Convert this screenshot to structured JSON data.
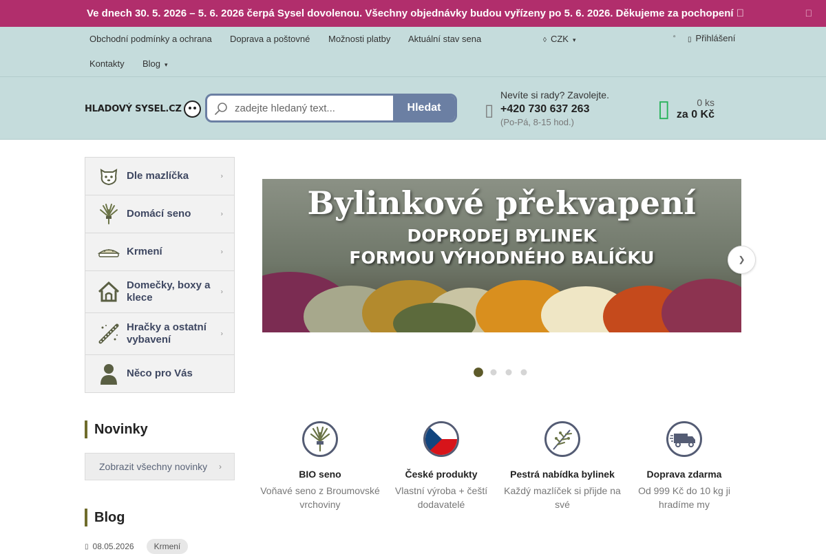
{
  "notice": {
    "text": "Ve dnech 30. 5. 2026 – 5. 6. 2026 čerpá Sysel dovolenou. Všechny objednávky budou vyřízeny po 5. 6. 2026. Děkujeme za pochopení ",
    "close": ""
  },
  "topnav": {
    "items": [
      "Obchodní podmínky a ochrana",
      "Doprava a poštovné",
      "Možnosti platby",
      "Aktuální stav sena",
      "Kontakty",
      "Blog"
    ],
    "currency": "CZK",
    "login": "Přihlášení"
  },
  "header": {
    "logo_text": "HLADOVÝ SYSEL.CZ",
    "search_placeholder": "zadejte hledaný text...",
    "search_button": "Hledat",
    "phone_prompt": "Nevíte si rady? Zavolejte.",
    "phone_number": "+420 730 637 263",
    "phone_hours": "(Po-Pá, 8-15 hod.)",
    "cart_count": "0 ks",
    "cart_total": "za 0 Kč"
  },
  "categories": [
    {
      "label": "Dle mazlíčka",
      "icon": "pet-face-icon"
    },
    {
      "label": "Domácí seno",
      "icon": "hay-icon"
    },
    {
      "label": "Krmení",
      "icon": "food-bowl-icon"
    },
    {
      "label": "Domečky, boxy a klece",
      "icon": "house-icon"
    },
    {
      "label": "Hračky a ostatní vybavení",
      "icon": "toys-icon"
    },
    {
      "label": "Něco pro Vás",
      "icon": "person-icon"
    }
  ],
  "sidebar": {
    "news_heading": "Novinky",
    "all_news": "Zobrazit všechny novinky",
    "blog_heading": "Blog",
    "blog_date": "08.05.2026",
    "blog_tag": "Krmení"
  },
  "banner": {
    "title": "Bylinkové překvapení",
    "line2": "DOPRODEJ BYLINEK",
    "line3": "FORMOU VÝHODNÉHO BALÍČKU",
    "slides": 4,
    "active_slide": 1
  },
  "features": [
    {
      "title": "BIO seno",
      "desc": "Voňavé seno z Broumovské vrchoviny",
      "icon": "hay-bundle-icon"
    },
    {
      "title": "České produkty",
      "desc": "Vlastní výroba + čeští dodavatelé",
      "icon": "czech-flag-icon"
    },
    {
      "title": "Pestrá nabídka bylinek",
      "desc": "Každý mazlíček si přijde na své",
      "icon": "herbs-icon"
    },
    {
      "title": "Doprava zdarma",
      "desc": "Od 999 Kč do 10 kg ji hradíme my",
      "icon": "delivery-truck-icon"
    }
  ]
}
